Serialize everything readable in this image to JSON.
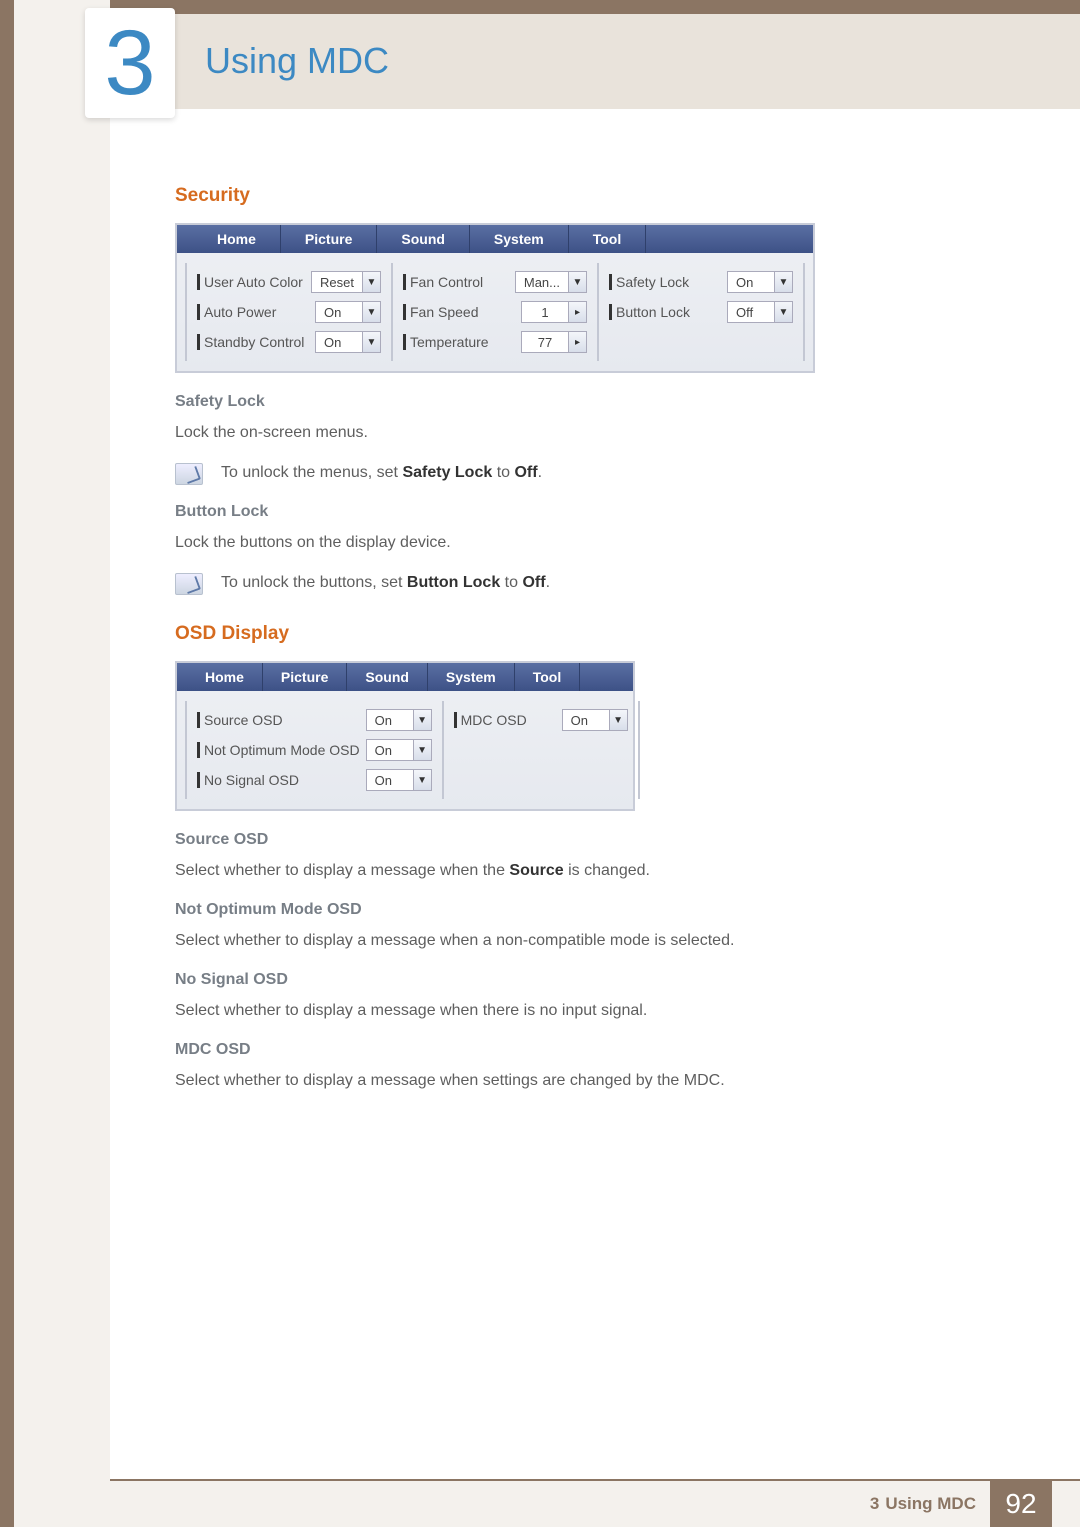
{
  "chapter": {
    "number": "3",
    "title": "Using MDC"
  },
  "security": {
    "heading": "Security",
    "tabs": [
      "Home",
      "Picture",
      "Sound",
      "System",
      "Tool"
    ],
    "col1": [
      {
        "label": "User Auto Color",
        "value": "Reset",
        "type": "dd"
      },
      {
        "label": "Auto Power",
        "value": "On",
        "type": "dd"
      },
      {
        "label": "Standby Control",
        "value": "On",
        "type": "dd"
      }
    ],
    "col2": [
      {
        "label": "Fan Control",
        "value": "Man...",
        "type": "dd"
      },
      {
        "label": "Fan Speed",
        "value": "1",
        "type": "spin"
      },
      {
        "label": "Temperature",
        "value": "77",
        "type": "spin"
      }
    ],
    "col3": [
      {
        "label": "Safety Lock",
        "value": "On",
        "type": "dd"
      },
      {
        "label": "Button Lock",
        "value": "Off",
        "type": "dd"
      }
    ],
    "safety_lock": {
      "heading": "Safety Lock",
      "text": "Lock the on-screen menus.",
      "note_pre": "To unlock the menus, set ",
      "note_bold1": "Safety Lock",
      "note_mid": " to ",
      "note_bold2": "Off",
      "note_post": "."
    },
    "button_lock": {
      "heading": "Button Lock",
      "text": "Lock the buttons on the display device.",
      "note_pre": "To unlock the buttons, set ",
      "note_bold1": "Button Lock",
      "note_mid": " to ",
      "note_bold2": "Off",
      "note_post": "."
    }
  },
  "osd": {
    "heading": "OSD Display",
    "tabs": [
      "Home",
      "Picture",
      "Sound",
      "System",
      "Tool"
    ],
    "colA": [
      {
        "label": "Source OSD",
        "value": "On"
      },
      {
        "label": "Not Optimum Mode OSD",
        "value": "On"
      },
      {
        "label": "No Signal OSD",
        "value": "On"
      }
    ],
    "colB": [
      {
        "label": "MDC OSD",
        "value": "On"
      }
    ],
    "source_osd": {
      "heading": "Source OSD",
      "text_pre": "Select whether to display a message when the ",
      "text_bold": "Source",
      "text_post": " is changed."
    },
    "not_optimum": {
      "heading": "Not Optimum Mode OSD",
      "text": "Select whether to display a message when a non-compatible mode is selected."
    },
    "no_signal": {
      "heading": "No Signal OSD",
      "text": "Select whether to display a message when there is no input signal."
    },
    "mdc_osd": {
      "heading": "MDC OSD",
      "text": "Select whether to display a message when settings are changed by the MDC."
    }
  },
  "footer": {
    "prefix": "3",
    "label": "Using MDC",
    "page": "92"
  }
}
